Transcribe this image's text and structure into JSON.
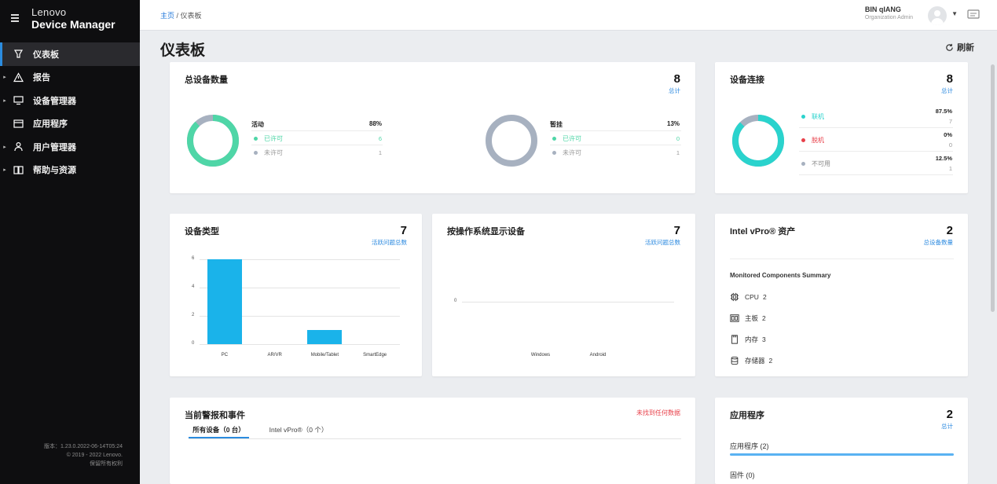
{
  "app": {
    "brand_top": "Lenovo",
    "brand_bottom": "Device Manager"
  },
  "sidebar": {
    "items": [
      {
        "label": "仪表板",
        "icon": "dashboard-icon",
        "active": true,
        "expandable": false
      },
      {
        "label": "报告",
        "icon": "warning-icon",
        "active": false,
        "expandable": true
      },
      {
        "label": "设备管理器",
        "icon": "monitor-icon",
        "active": false,
        "expandable": true
      },
      {
        "label": "应用程序",
        "icon": "app-window-icon",
        "active": false,
        "expandable": false
      },
      {
        "label": "用户管理器",
        "icon": "user-icon",
        "active": false,
        "expandable": true
      },
      {
        "label": "帮助与资源",
        "icon": "book-icon",
        "active": false,
        "expandable": true
      }
    ],
    "version": "版本：1.23.0.2022-06-14T05:24",
    "copyright": "© 2019 - 2022 Lenovo.",
    "rights": "保留所有权利"
  },
  "header": {
    "breadcrumb_home": "主页",
    "breadcrumb_sep": " / ",
    "breadcrumb_current": "仪表板",
    "user_name": "BIN qIANG",
    "user_role": "Organization Admin"
  },
  "page": {
    "title": "仪表板",
    "refresh_label": "刷新"
  },
  "total_devices": {
    "title": "总设备数量",
    "count": "8",
    "count_label": "总计",
    "active": {
      "label": "活动",
      "percent": "88%",
      "licensed_label": "已许可",
      "licensed": "6",
      "unlicensed_label": "未许可",
      "unlicensed": "1"
    },
    "suspended": {
      "label": "暂挂",
      "percent": "13%",
      "licensed_label": "已许可",
      "licensed": "0",
      "unlicensed_label": "未许可",
      "unlicensed": "1"
    }
  },
  "connectivity": {
    "title": "设备连接",
    "count": "8",
    "count_label": "总计",
    "rows": [
      {
        "label": "联机",
        "percent": "87.5%",
        "count": "7",
        "color": "#2ad3cd"
      },
      {
        "label": "脱机",
        "percent": "0%",
        "count": "0",
        "color": "#e8404a"
      },
      {
        "label": "不可用",
        "percent": "12.5%",
        "count": "1",
        "color": "#a7b1c0"
      }
    ]
  },
  "device_types": {
    "title": "设备类型",
    "count": "7",
    "count_label": "活跃问题总数"
  },
  "os_devices": {
    "title": "按操作系统显示设备",
    "count": "7",
    "count_label": "活跃问题总数"
  },
  "vpro": {
    "title": "Intel vPro® 资产",
    "count": "2",
    "count_label": "总设备数量",
    "summary_title": "Monitored Components Summary",
    "components": [
      {
        "icon": "cpu-icon",
        "label": "CPU",
        "count": "2"
      },
      {
        "icon": "motherboard-icon",
        "label": "主板",
        "count": "2"
      },
      {
        "icon": "memory-icon",
        "label": "内存",
        "count": "3"
      },
      {
        "icon": "storage-icon",
        "label": "存储器",
        "count": "2"
      }
    ]
  },
  "alerts": {
    "title": "当前警报和事件",
    "no_data": "未找到任何数据",
    "tabs": [
      {
        "label": "所有设备（0 台）",
        "active": true
      },
      {
        "label": "Intel vPro®（0 个）",
        "active": false
      }
    ]
  },
  "applications": {
    "title": "应用程序",
    "count": "2",
    "count_label": "总计",
    "rows": [
      {
        "label": "应用程序 (2)"
      },
      {
        "label": "固件 (0)"
      }
    ]
  },
  "colors": {
    "accent": "#2b8cdf",
    "teal": "#2ad3cd",
    "donut_green": "#4fd6a7",
    "grey": "#a7b1c0",
    "bar": "#1ab3ea",
    "red": "#e8404a"
  },
  "chart_data": [
    {
      "type": "bar",
      "title": "设备类型",
      "categories": [
        "PC",
        "AR/VR",
        "Mobile/Tablet",
        "SmartEdge"
      ],
      "values": [
        6,
        0,
        1,
        0
      ],
      "ylim": [
        0,
        6
      ],
      "yticks": [
        0,
        2,
        4,
        6
      ],
      "grid": true
    },
    {
      "type": "bar",
      "title": "按操作系统显示设备",
      "categories": [
        "Windows",
        "Android"
      ],
      "values": [
        0,
        0
      ],
      "yticks": [
        0
      ],
      "grid": true
    },
    {
      "type": "pie",
      "title": "总设备数量 - 活动",
      "values": [
        88,
        12
      ]
    },
    {
      "type": "pie",
      "title": "总设备数量 - 暂挂",
      "values": [
        13,
        87
      ]
    },
    {
      "type": "pie",
      "title": "设备连接",
      "categories": [
        "联机",
        "脱机",
        "不可用"
      ],
      "values": [
        87.5,
        0,
        12.5
      ]
    }
  ]
}
